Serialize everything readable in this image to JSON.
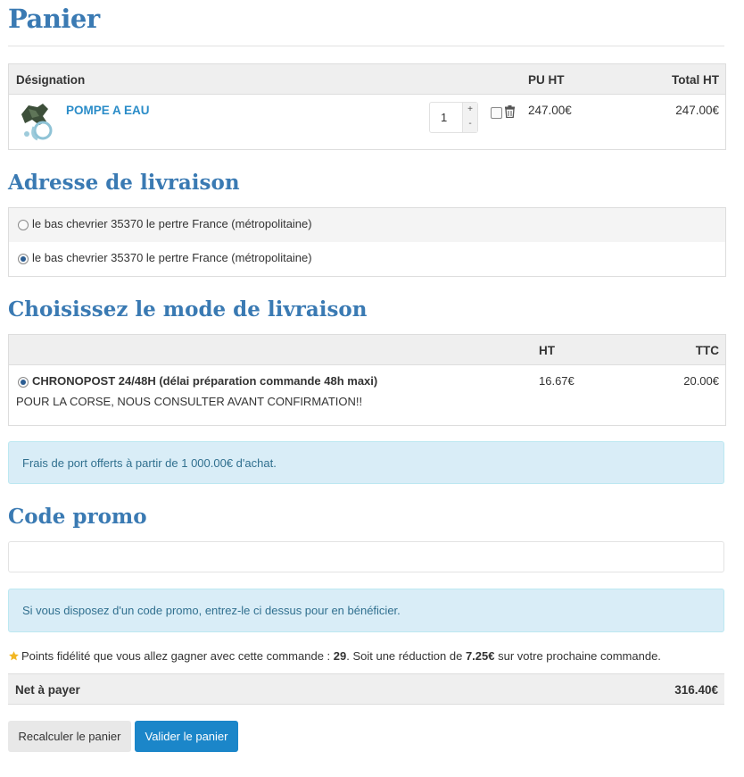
{
  "title": "Panier",
  "cart": {
    "headers": {
      "designation": "Désignation",
      "pu_ht": "PU HT",
      "total_ht": "Total HT"
    },
    "items": [
      {
        "name": "POMPE A EAU",
        "quantity": "1",
        "pu_ht": "247.00€",
        "total_ht": "247.00€",
        "qty_plus": "+",
        "qty_minus": "-"
      }
    ]
  },
  "delivery_address": {
    "title": "Adresse de livraison",
    "options": [
      {
        "label": "le bas chevrier 35370 le pertre France (métropolitaine)",
        "selected": false
      },
      {
        "label": "le bas chevrier 35370 le pertre France (métropolitaine)",
        "selected": true
      }
    ]
  },
  "shipping": {
    "title": "Choisissez le mode de livraison",
    "headers": {
      "ht": "HT",
      "ttc": "TTC"
    },
    "options": [
      {
        "name": "CHRONOPOST 24/48H (délai préparation commande 48h maxi)",
        "note": "POUR LA CORSE, NOUS CONSULTER AVANT CONFIRMATION!!",
        "ht": "16.67€",
        "ttc": "20.00€",
        "selected": true
      }
    ]
  },
  "free_shipping_info": "Frais de port offerts à partir de 1 000.00€ d'achat.",
  "promo": {
    "title": "Code promo",
    "value": "",
    "info": "Si vous disposez d'un code promo, entrez-le ci dessus pour en bénéficier."
  },
  "loyalty": {
    "text_before": "Points fidélité que vous allez gagner avec cette commande : ",
    "points": "29",
    "text_middle": ". Soit une réduction de ",
    "discount": "7.25€",
    "text_after": " sur votre prochaine commande."
  },
  "net": {
    "label": "Net à payer",
    "value": "316.40€"
  },
  "buttons": {
    "recalc": "Recalculer le panier",
    "validate": "Valider le panier"
  },
  "colors": {
    "heading": "#3a7ab3",
    "link": "#2a8cc8",
    "primary_button": "#1b86c9",
    "info_bg": "#d9edf7",
    "info_text": "#31708f"
  },
  "icons": {
    "trash": "trash-icon",
    "star": "star-icon"
  }
}
